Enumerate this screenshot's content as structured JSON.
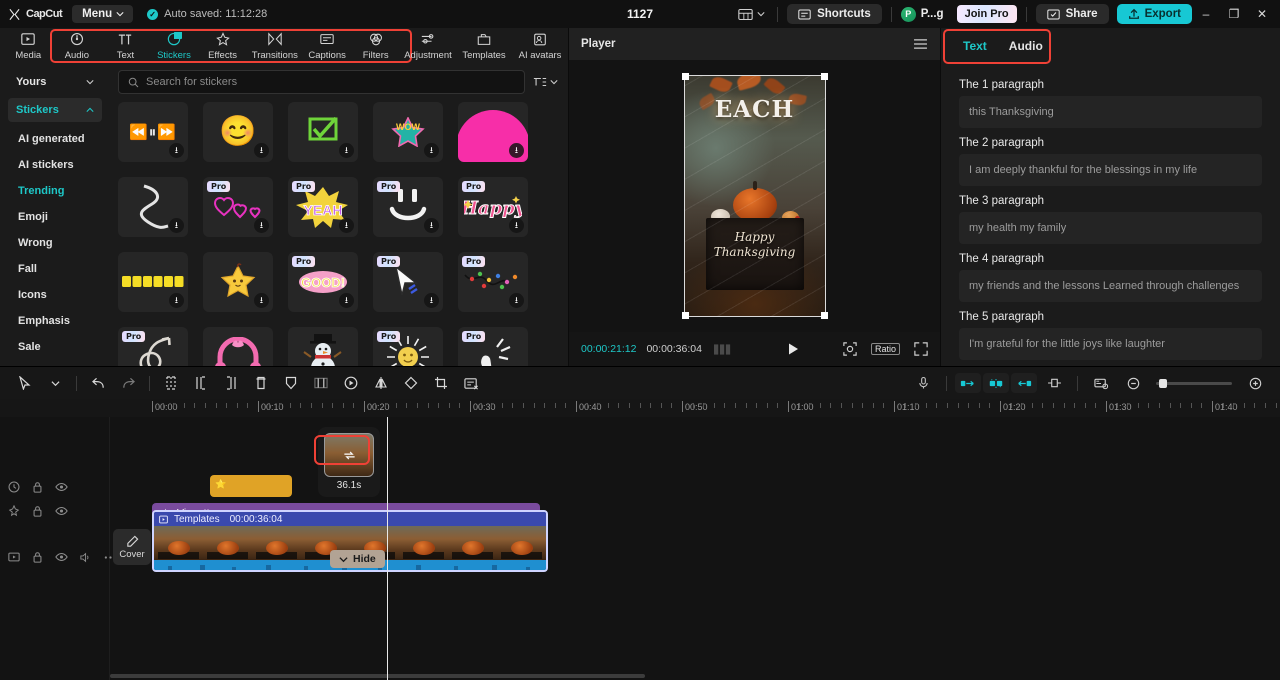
{
  "titlebar": {
    "brand": "CapCut",
    "menu_label": "Menu",
    "autosave_text": "Auto saved: 11:12:28",
    "project_title": "1127",
    "shortcuts_label": "Shortcuts",
    "account_initial": "P",
    "account_name": "P...g",
    "join_pro_label": "Join Pro",
    "share_label": "Share",
    "export_label": "Export",
    "minimize_glyph": "–",
    "maximize_glyph": "❐",
    "close_glyph": "✕"
  },
  "tabs": [
    {
      "label": "Media",
      "icon": "media-icon",
      "active": false
    },
    {
      "label": "Audio",
      "icon": "audio-icon",
      "active": false
    },
    {
      "label": "Text",
      "icon": "text-icon",
      "active": false
    },
    {
      "label": "Stickers",
      "icon": "stickers-icon",
      "active": true
    },
    {
      "label": "Effects",
      "icon": "effects-icon",
      "active": false
    },
    {
      "label": "Transitions",
      "icon": "transitions-icon",
      "active": false
    },
    {
      "label": "Captions",
      "icon": "captions-icon",
      "active": false
    },
    {
      "label": "Filters",
      "icon": "filters-icon",
      "active": false
    },
    {
      "label": "Adjustment",
      "icon": "adjustment-icon",
      "active": false
    },
    {
      "label": "Templates",
      "icon": "templates-icon",
      "active": false
    },
    {
      "label": "AI avatars",
      "icon": "ai-avatars-icon",
      "active": false
    }
  ],
  "sidebar": {
    "yours_label": "Yours",
    "stickers_label": "Stickers",
    "items": [
      {
        "label": "AI generated",
        "active": false
      },
      {
        "label": "AI stickers",
        "active": false
      },
      {
        "label": "Trending",
        "active": true
      },
      {
        "label": "Emoji",
        "active": false
      },
      {
        "label": "Wrong",
        "active": false
      },
      {
        "label": "Fall",
        "active": false
      },
      {
        "label": "Icons",
        "active": false
      },
      {
        "label": "Emphasis",
        "active": false
      },
      {
        "label": "Sale",
        "active": false
      }
    ]
  },
  "search": {
    "placeholder": "Search for stickers",
    "icon": "search-icon",
    "filter_icon": "sort-filter-icon"
  },
  "stickers": {
    "pro_badge": "Pro",
    "download_glyph": "⭳",
    "grid": [
      {
        "name": "playback-controls-sticker",
        "glyph": "⏪⏸⏩",
        "pro": false,
        "download": true,
        "kind": "glyph-sm"
      },
      {
        "name": "blushing-face-sticker",
        "glyph": "😊",
        "pro": false,
        "download": true,
        "kind": "emoji"
      },
      {
        "name": "green-checkmark-sticker",
        "glyph": "✅",
        "pro": false,
        "download": true,
        "kind": "check"
      },
      {
        "name": "wow-star-sticker",
        "glyph": "⭐",
        "pro": false,
        "download": true,
        "kind": "wow"
      },
      {
        "name": "pink-blob-sticker",
        "glyph": "",
        "pro": false,
        "download": true,
        "kind": "blob"
      },
      {
        "name": "white-squiggle-arrow-sticker",
        "glyph": "⤳",
        "pro": false,
        "download": true,
        "kind": "squiggle"
      },
      {
        "name": "pink-hearts-sticker",
        "glyph": "♡♡",
        "pro": true,
        "download": true,
        "kind": "hearts"
      },
      {
        "name": "yeah-burst-sticker",
        "glyph": "YEAH",
        "pro": true,
        "download": true,
        "kind": "yeah"
      },
      {
        "name": "smiley-brush-sticker",
        "glyph": "◡",
        "pro": true,
        "download": true,
        "kind": "smiley"
      },
      {
        "name": "happy-lettering-sticker",
        "glyph": "Happy",
        "pro": true,
        "download": true,
        "kind": "happy"
      },
      {
        "name": "yellow-squares-sticker",
        "glyph": "",
        "pro": false,
        "download": true,
        "kind": "squares"
      },
      {
        "name": "yellow-star-sticker",
        "glyph": "⭐",
        "pro": false,
        "download": true,
        "kind": "star"
      },
      {
        "name": "good-bubble-sticker",
        "glyph": "GOOD!",
        "pro": true,
        "download": true,
        "kind": "good"
      },
      {
        "name": "cursor-arrow-sticker",
        "glyph": "➤",
        "pro": true,
        "download": true,
        "kind": "cursor"
      },
      {
        "name": "string-lights-sticker",
        "glyph": "",
        "pro": true,
        "download": true,
        "kind": "lights"
      },
      {
        "name": "curly-arrow-sticker",
        "glyph": "⤴",
        "pro": true,
        "download": true,
        "kind": "curlyarrow"
      },
      {
        "name": "pink-headphones-sticker",
        "glyph": "🎧",
        "pro": false,
        "download": true,
        "kind": "headphones"
      },
      {
        "name": "snowman-sticker",
        "glyph": "⛄",
        "pro": false,
        "download": true,
        "kind": "snowman"
      },
      {
        "name": "smiling-sun-sticker",
        "glyph": "☀",
        "pro": true,
        "download": true,
        "kind": "sun"
      },
      {
        "name": "hand-sparkle-sticker",
        "glyph": "✋",
        "pro": true,
        "download": true,
        "kind": "hand"
      }
    ]
  },
  "player": {
    "title": "Player",
    "menu_icon": "hamburger-icon",
    "current_time": "00:00:21:12",
    "total_time": "00:00:36:04",
    "frames_icon": "frames-icon",
    "play_icon": "play-icon",
    "fit_icon": "fit-to-screen-icon",
    "ratio_label": "Ratio",
    "fullscreen_icon": "fullscreen-icon",
    "canvas": {
      "headline": "EACH",
      "crate_line1": "Happy",
      "crate_line2": "Thanksgiving"
    }
  },
  "inspector": {
    "tabs": [
      {
        "label": "Text",
        "active": true
      },
      {
        "label": "Audio",
        "active": false
      }
    ],
    "paragraphs": [
      {
        "label": "The 1 paragraph",
        "value": "this Thanksgiving"
      },
      {
        "label": "The 2 paragraph",
        "value": "I am deeply thankful for the blessings in my life"
      },
      {
        "label": "The 3 paragraph",
        "value": "my health my family"
      },
      {
        "label": "The 4 paragraph",
        "value": "my friends and the lessons Learned through challenges"
      },
      {
        "label": "The 5 paragraph",
        "value": "I'm grateful for the little joys like laughter"
      }
    ]
  },
  "timeline": {
    "tools": [
      {
        "name": "select-tool",
        "icon": "cursor-icon"
      },
      {
        "name": "select-dropdown",
        "icon": "chevron-down-icon"
      },
      {
        "name": "undo-button",
        "icon": "undo-icon"
      },
      {
        "name": "redo-button",
        "icon": "redo-icon"
      },
      {
        "name": "split-button",
        "icon": "split-icon"
      },
      {
        "name": "trim-left-button",
        "icon": "trim-left-icon"
      },
      {
        "name": "trim-right-button",
        "icon": "trim-right-icon"
      },
      {
        "name": "delete-button",
        "icon": "trash-icon"
      },
      {
        "name": "freeze-button",
        "icon": "shield-icon"
      },
      {
        "name": "crop-frame-button",
        "icon": "frame-icon"
      },
      {
        "name": "reverse-button",
        "icon": "reverse-icon"
      },
      {
        "name": "mirror-button",
        "icon": "mirror-icon"
      },
      {
        "name": "rotate-button",
        "icon": "rotate-icon"
      },
      {
        "name": "crop-button",
        "icon": "crop-icon"
      },
      {
        "name": "auto-captions-button",
        "icon": "captions-remove-icon"
      }
    ],
    "right_tools": [
      {
        "name": "voiceover-button",
        "icon": "microphone-icon",
        "on": false
      },
      {
        "name": "keyframe-prev-button",
        "icon": "keyframe-left-icon",
        "on": true
      },
      {
        "name": "keyframe-add-button",
        "icon": "keyframe-add-icon",
        "on": true
      },
      {
        "name": "keyframe-next-button",
        "icon": "keyframe-right-icon",
        "on": true
      },
      {
        "name": "marker-button",
        "icon": "marker-icon",
        "on": false
      },
      {
        "name": "thumbnail-view-button",
        "icon": "thumbnail-icon",
        "on": false
      },
      {
        "name": "zoom-out-button",
        "icon": "zoom-out-icon",
        "on": false
      },
      {
        "name": "zoom-in-button",
        "icon": "zoom-in-icon",
        "on": false
      }
    ],
    "ruler_labels": [
      "00:00",
      "00:10",
      "00:20",
      "00:30",
      "00:40",
      "00:50",
      "01:00",
      "01:10",
      "01:20",
      "01:30",
      "01:40"
    ],
    "tracks": [
      {
        "name": "sticker-track",
        "icon": "clock-icon",
        "lock": "lock-icon",
        "eye": "eye-icon"
      },
      {
        "name": "effect-track",
        "icon": "effects-icon",
        "lock": "lock-icon",
        "eye": "eye-icon"
      },
      {
        "name": "video-track",
        "icon": "video-icon",
        "lock": "lock-icon",
        "eye": "eye-icon",
        "mute": "speaker-icon",
        "more": "more-icon"
      }
    ],
    "sticker_clip_label": "",
    "effect_clip_label": "Vignette",
    "video_clip_label": "Templates",
    "video_clip_duration": "00:00:36:04",
    "cover_label": "Cover",
    "hide_label": "Hide",
    "tooltip_duration": "36.1s",
    "tooltip_replace_icon": "replace-icon"
  },
  "colors": {
    "accent_teal": "#1ec8c8",
    "highlight_red": "#ef4136",
    "effect_purple": "#7a4b9e",
    "sticker_orange": "#e0a326",
    "video_blue": "#2f3f9e",
    "audio_blue": "#1f8fd0"
  }
}
